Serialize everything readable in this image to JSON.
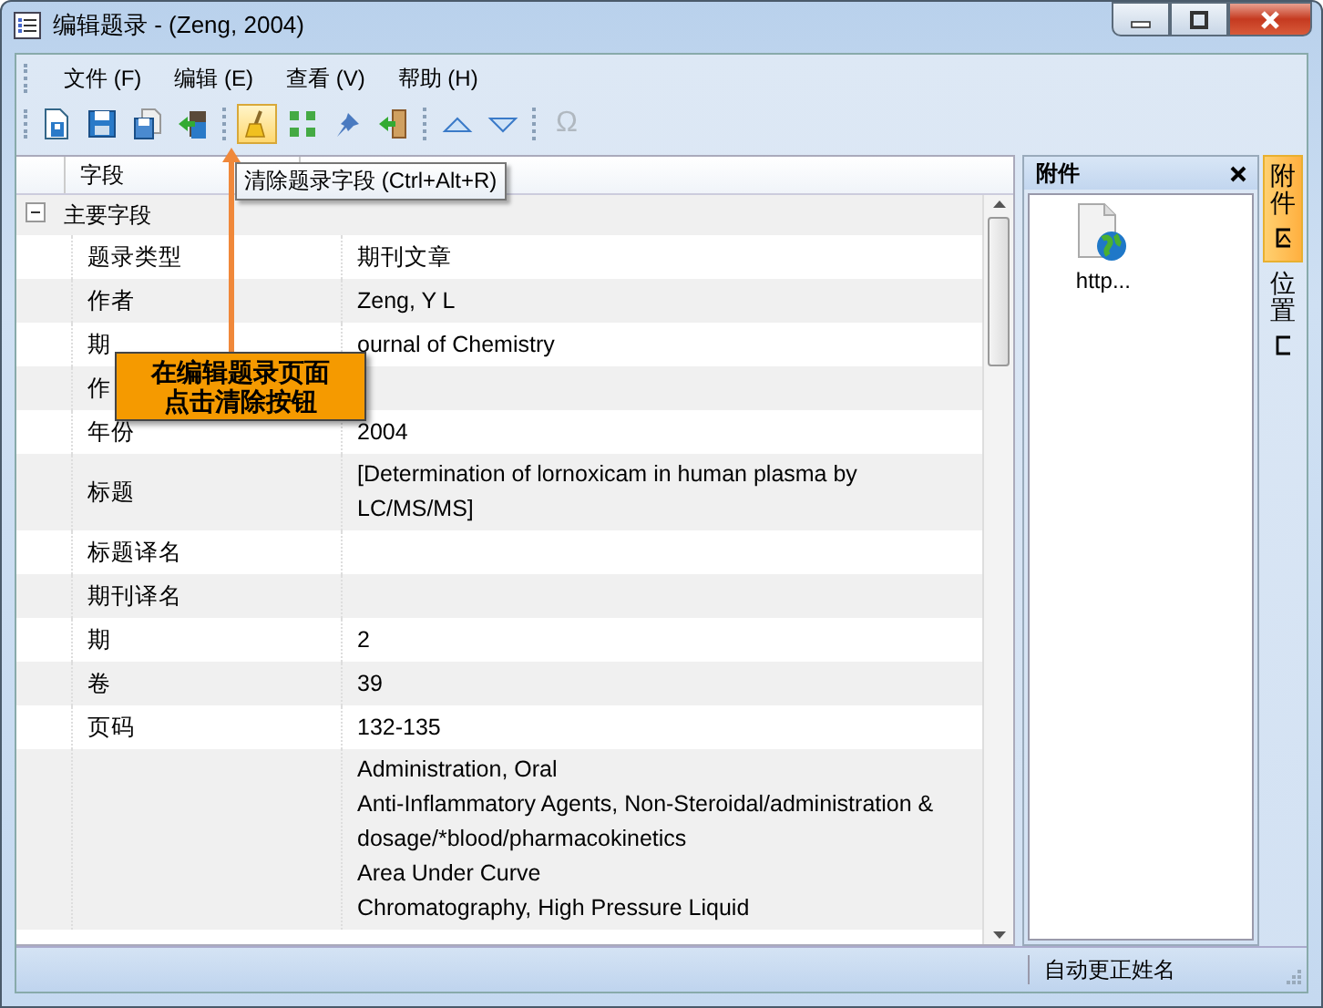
{
  "window": {
    "title": "编辑题录 - (Zeng, 2004)"
  },
  "menu": [
    "文件 (F)",
    "编辑 (E)",
    "查看 (V)",
    "帮助 (H)"
  ],
  "toolbar": [
    {
      "kind": "doc",
      "active": false
    },
    {
      "kind": "save",
      "active": false
    },
    {
      "kind": "copy",
      "active": false
    },
    {
      "kind": "import",
      "active": false
    },
    {
      "kind": "sep"
    },
    {
      "kind": "broom",
      "active": true
    },
    {
      "kind": "grid",
      "active": false
    },
    {
      "kind": "pin",
      "active": false
    },
    {
      "kind": "exit",
      "active": false
    },
    {
      "kind": "sep"
    },
    {
      "kind": "up",
      "active": false
    },
    {
      "kind": "down",
      "active": false
    },
    {
      "kind": "sep"
    },
    {
      "kind": "char",
      "label": "Ω",
      "disabled": true
    }
  ],
  "tooltip": "清除题录字段 (Ctrl+Alt+R)",
  "table": {
    "columns": [
      "字段"
    ],
    "group": {
      "label": "主要字段",
      "expanded": true
    },
    "rows": [
      {
        "field": "题录类型",
        "value": "期刊文章"
      },
      {
        "field": "作者",
        "value": "Zeng, Y L"
      },
      {
        "field": "期",
        "value": "ournal of Chemistry"
      },
      {
        "field": "作",
        "value": ""
      },
      {
        "field": "年份",
        "value": "2004"
      },
      {
        "field": "标题",
        "value": "[Determination of lornoxicam in human plasma by LC/MS/MS]"
      },
      {
        "field": "标题译名",
        "value": ""
      },
      {
        "field": "期刊译名",
        "value": ""
      },
      {
        "field": "期",
        "value": "2"
      },
      {
        "field": "卷",
        "value": "39"
      },
      {
        "field": "页码",
        "value": "132-135"
      },
      {
        "field": "",
        "lines": [
          "Administration, Oral",
          "Anti-Inflammatory Agents, Non-Steroidal/administration & dosage/*blood/pharmacokinetics",
          "Area Under Curve",
          "Chromatography, High Pressure Liquid"
        ]
      }
    ]
  },
  "callout": {
    "lines": [
      "在编辑题录页面",
      "点击清除按钮"
    ]
  },
  "attachments": {
    "title": "附件",
    "items": [
      {
        "label": "http..."
      }
    ]
  },
  "side_tabs": [
    {
      "label": "附件",
      "selected": true
    },
    {
      "label": "位置",
      "selected": false
    }
  ],
  "status_bar": {
    "text": "自动更正姓名"
  }
}
